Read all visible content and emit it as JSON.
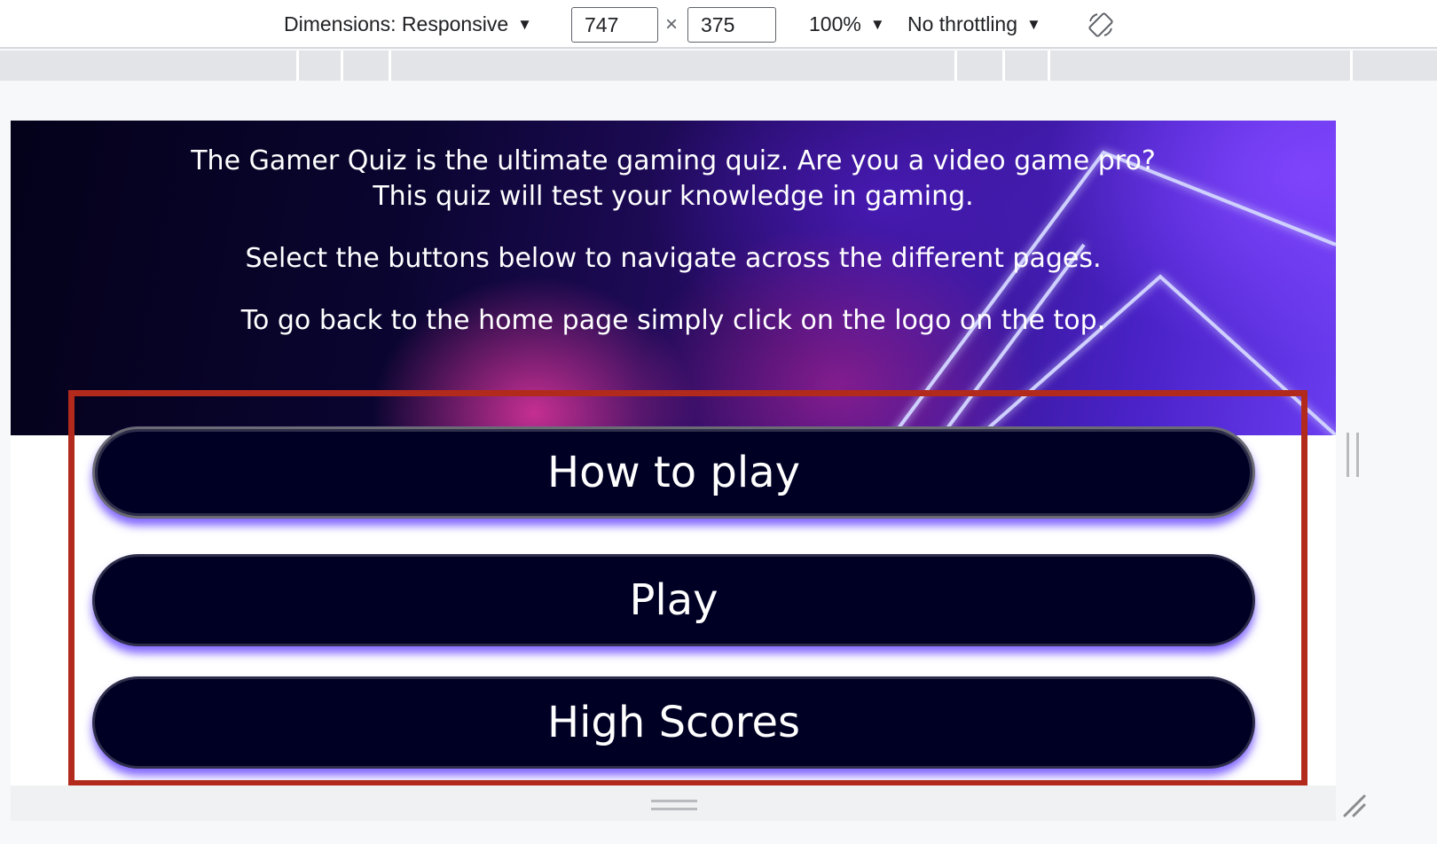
{
  "devtools": {
    "dimensions_label": "Dimensions: Responsive",
    "width_value": "747",
    "times_symbol": "×",
    "height_value": "375",
    "zoom_label": "100%",
    "throttling_label": "No throttling",
    "caret": "▼"
  },
  "page": {
    "intro_text": "The Gamer Quiz is the ultimate gaming quiz. Are you a video game pro? This quiz will test your knowledge in gaming.",
    "nav_hint": "Select the buttons below to navigate across the different pages.",
    "home_hint": "To go back to the home page simply click on the logo on the top.",
    "buttons": {
      "how_to_play": "How to play",
      "play": "Play",
      "high_scores": "High Scores"
    }
  },
  "colors": {
    "button_bg": "#000024",
    "button_glow": "#6e50ff",
    "highlight_border": "#b22a1c"
  },
  "icons": {
    "rotate": "rotate-icon",
    "resize_corner": "resize-corner-icon"
  }
}
